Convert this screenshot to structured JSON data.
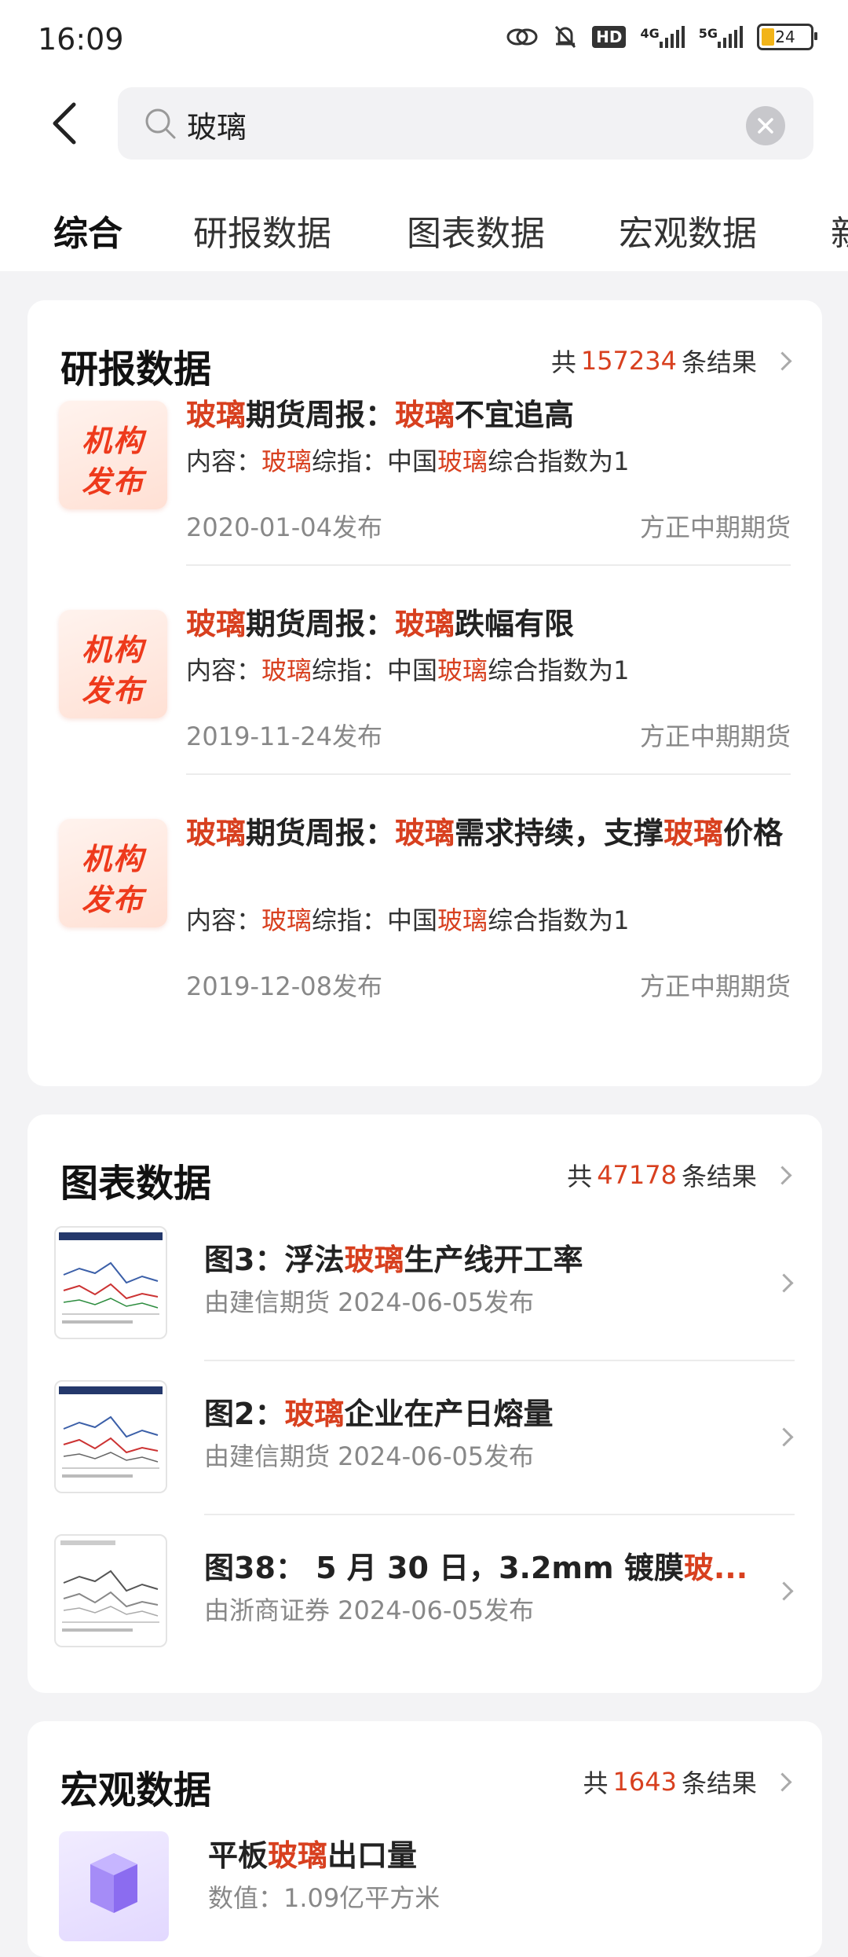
{
  "status": {
    "time": "16:09",
    "battery": "24",
    "hd": "HD",
    "net1": "4G",
    "net2": "5G"
  },
  "search": {
    "value": "玻璃"
  },
  "tabs": [
    "综合",
    "研报数据",
    "图表数据",
    "宏观数据",
    "新"
  ],
  "research": {
    "title": "研报数据",
    "count_prefix": "共",
    "count": "157234",
    "count_suffix": "条结果",
    "badge_line1": "机构",
    "badge_line2": "发布",
    "content_label": "内容：",
    "items": [
      {
        "title_parts": [
          [
            "玻璃",
            1
          ],
          [
            "期货周报：",
            0
          ],
          [
            "玻璃",
            1
          ],
          [
            "不宜追高",
            0
          ]
        ],
        "content_parts": [
          [
            "玻璃",
            1
          ],
          [
            "综指：中国",
            0
          ],
          [
            "玻璃",
            1
          ],
          [
            "综合指数为1",
            0
          ]
        ],
        "date": "2020-01-04发布",
        "source": "方正中期期货"
      },
      {
        "title_parts": [
          [
            "玻璃",
            1
          ],
          [
            "期货周报：",
            0
          ],
          [
            "玻璃",
            1
          ],
          [
            "跌幅有限",
            0
          ]
        ],
        "content_parts": [
          [
            "玻璃",
            1
          ],
          [
            "综指：中国",
            0
          ],
          [
            "玻璃",
            1
          ],
          [
            "综合指数为1",
            0
          ]
        ],
        "date": "2019-11-24发布",
        "source": "方正中期期货"
      },
      {
        "title_parts": [
          [
            "玻璃",
            1
          ],
          [
            "期货周报：",
            0
          ],
          [
            "玻璃",
            1
          ],
          [
            "需求持续，支撑",
            0
          ],
          [
            "玻璃",
            1
          ],
          [
            "价格",
            0
          ]
        ],
        "content_parts": [
          [
            "玻璃",
            1
          ],
          [
            "综指：中国",
            0
          ],
          [
            "玻璃",
            1
          ],
          [
            "综合指数为1",
            0
          ]
        ],
        "date": "2019-12-08发布",
        "source": "方正中期期货"
      }
    ]
  },
  "charts": {
    "title": "图表数据",
    "count_prefix": "共",
    "count": "47178",
    "count_suffix": "条结果",
    "items": [
      {
        "title_parts": [
          [
            "图3：浮法",
            0
          ],
          [
            "玻璃",
            1
          ],
          [
            "生产线开工率",
            0
          ]
        ],
        "sub": "由建信期货 2024-06-05发布"
      },
      {
        "title_parts": [
          [
            "图2：",
            0
          ],
          [
            "玻璃",
            1
          ],
          [
            "企业在产日熔量",
            0
          ]
        ],
        "sub": "由建信期货 2024-06-05发布"
      },
      {
        "title_parts": [
          [
            "图38： 5 月 30 日，3.2mm 镀膜",
            0
          ],
          [
            "玻...",
            1
          ]
        ],
        "sub": "由浙商证券 2024-06-05发布"
      }
    ]
  },
  "macro": {
    "title": "宏观数据",
    "count_prefix": "共",
    "count": "1643",
    "count_suffix": "条结果",
    "item_title_parts": [
      [
        "平板",
        0
      ],
      [
        "玻璃",
        1
      ],
      [
        "出口量",
        0
      ]
    ],
    "item_sub": "数值：1.09亿平方米"
  },
  "colors": {
    "highlight": "#d8401f",
    "badge": "#ee3a1c"
  }
}
